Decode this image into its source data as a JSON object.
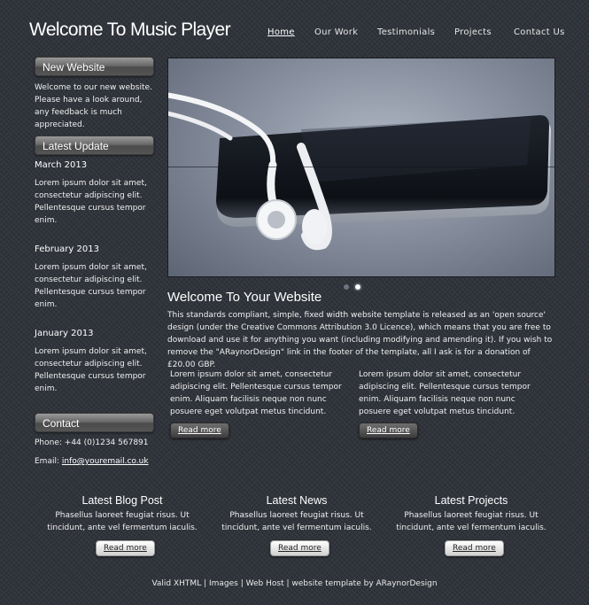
{
  "site": {
    "title": "Welcome To Music Player"
  },
  "nav": [
    {
      "label": "Home",
      "active": true
    },
    {
      "label": "Our Work"
    },
    {
      "label": "Testimonials"
    },
    {
      "label": "Projects"
    },
    {
      "label": "Contact Us"
    }
  ],
  "sidebar": {
    "new_website": {
      "heading": "New Website",
      "text": "Welcome to our new website. Please have a look around, any feedback is much appreciated."
    },
    "latest_update": {
      "heading": "Latest Update",
      "entries": [
        {
          "date": "March 2013",
          "text": "Lorem ipsum dolor sit amet, consectetur adipiscing elit. Pellentesque cursus tempor enim."
        },
        {
          "date": "February 2013",
          "text": "Lorem ipsum dolor sit amet, consectetur adipiscing elit. Pellentesque cursus tempor enim."
        },
        {
          "date": "January 2013",
          "text": "Lorem ipsum dolor sit amet, consectetur adipiscing elit. Pellentesque cursus tempor enim."
        }
      ]
    },
    "contact": {
      "heading": "Contact",
      "phone": "Phone: +44 (0)1234 567891",
      "email_label": "Email: ",
      "email": "info@youremail.co.uk"
    }
  },
  "banner": {
    "image": "earphones-and-phone-photo",
    "slides": 2,
    "active_slide": 2
  },
  "main": {
    "title": "Welcome To Your Website",
    "intro": "This standards compliant, simple, fixed width website template is released as an 'open source' design (under the Creative Commons Attribution 3.0 Licence), which means that you are free to download and use it for anything you want (including modifying and amending it). If you wish to remove the \"ARaynorDesign\" link in the footer of the template, all I ask is for a donation of £20.00 GBP.",
    "columns": [
      {
        "text": "Lorem ipsum dolor sit amet, consectetur adipiscing elit. Pellentesque cursus tempor enim. Aliquam facilisis neque non nunc posuere eget volutpat metus tincidunt.",
        "button": "Read more"
      },
      {
        "text": "Lorem ipsum dolor sit amet, consectetur adipiscing elit. Pellentesque cursus tempor enim. Aliquam facilisis neque non nunc posuere eget volutpat metus tincidunt.",
        "button": "Read more"
      }
    ]
  },
  "footer_cols": [
    {
      "title": "Latest Blog Post",
      "text": "Phasellus laoreet feugiat risus. Ut tincidunt, ante vel fermentum iaculis.",
      "button": "Read more"
    },
    {
      "title": "Latest News",
      "text": "Phasellus laoreet feugiat risus. Ut tincidunt, ante vel fermentum iaculis.",
      "button": "Read more"
    },
    {
      "title": "Latest Projects",
      "text": "Phasellus laoreet feugiat risus. Ut tincidunt, ante vel fermentum iaculis.",
      "button": "Read more"
    }
  ],
  "footer": {
    "links": [
      "Valid XHTML",
      "Images",
      "Web Host"
    ],
    "separator": " | ",
    "credit": "website template by ARaynorDesign"
  }
}
